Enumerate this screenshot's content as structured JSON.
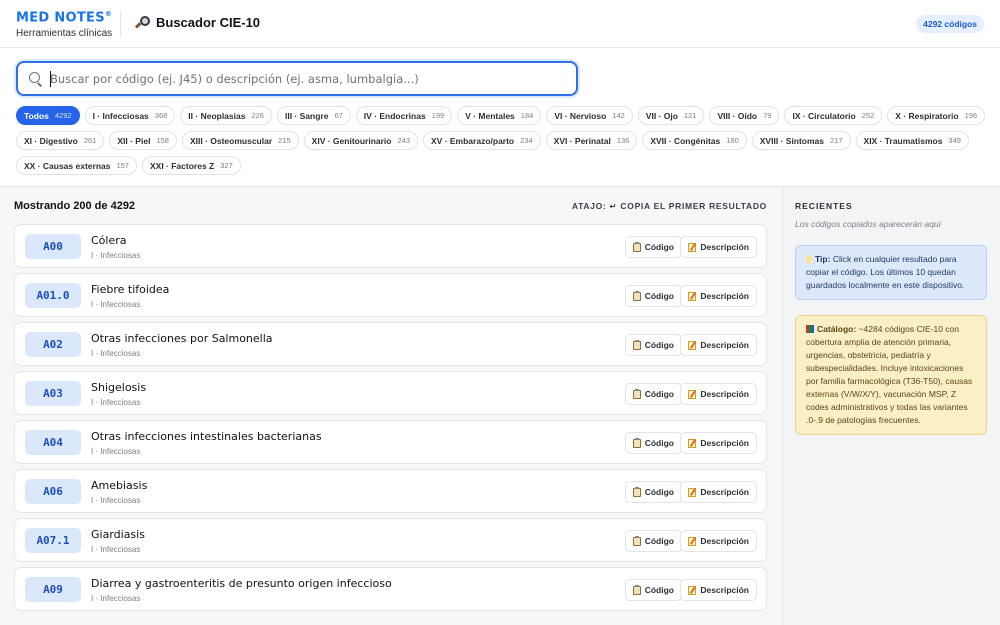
{
  "header": {
    "brand": "MED NOTES",
    "brand_mark": "®",
    "brand_subtitle": "Herramientas clínicas",
    "title": "Buscador CIE-10",
    "title_icon": "magnifier-icon",
    "total_badge": "4292 códigos"
  },
  "search": {
    "placeholder": "Buscar por código (ej. J45) o descripción (ej. asma, lumbalgia...)",
    "value": "",
    "icon": "search-icon"
  },
  "chapters": [
    {
      "label": "Todos",
      "count": "4292",
      "active": true
    },
    {
      "label": "I · Infecciosas",
      "count": "368"
    },
    {
      "label": "II · Neoplasias",
      "count": "226"
    },
    {
      "label": "III · Sangre",
      "count": "67"
    },
    {
      "label": "IV · Endocrinas",
      "count": "199"
    },
    {
      "label": "V · Mentales",
      "count": "184"
    },
    {
      "label": "VI · Nervioso",
      "count": "142"
    },
    {
      "label": "VII · Ojo",
      "count": "121"
    },
    {
      "label": "VIII · Oído",
      "count": "79"
    },
    {
      "label": "IX · Circulatorio",
      "count": "252"
    },
    {
      "label": "X · Respiratorio",
      "count": "196"
    },
    {
      "label": "XI · Digestivo",
      "count": "261"
    },
    {
      "label": "XII · Piel",
      "count": "158"
    },
    {
      "label": "XIII · Osteomuscular",
      "count": "215"
    },
    {
      "label": "XIV · Genitourinario",
      "count": "243"
    },
    {
      "label": "XV · Embarazo/parto",
      "count": "234"
    },
    {
      "label": "XVI · Perinatal",
      "count": "136"
    },
    {
      "label": "XVII · Congénitas",
      "count": "160"
    },
    {
      "label": "XVIII · Síntomas",
      "count": "217"
    },
    {
      "label": "XIX · Traumatismos",
      "count": "349"
    },
    {
      "label": "XX · Causas externas",
      "count": "157"
    },
    {
      "label": "XXI · Factores Z",
      "count": "327"
    }
  ],
  "results": {
    "summary": "Mostrando 200 de 4292",
    "shortcut": "ATAJO: ↵ COPIA EL PRIMER RESULTADO",
    "copy_code_label": "Código",
    "copy_desc_label": "Descripción",
    "items": [
      {
        "code": "A00",
        "title": "Cólera",
        "chapter": "I · Infecciosas"
      },
      {
        "code": "A01.0",
        "title": "Fiebre tifoidea",
        "chapter": "I · Infecciosas"
      },
      {
        "code": "A02",
        "title": "Otras infecciones por Salmonella",
        "chapter": "I · Infecciosas"
      },
      {
        "code": "A03",
        "title": "Shigelosis",
        "chapter": "I · Infecciosas"
      },
      {
        "code": "A04",
        "title": "Otras infecciones intestinales bacterianas",
        "chapter": "I · Infecciosas"
      },
      {
        "code": "A06",
        "title": "Amebiasis",
        "chapter": "I · Infecciosas"
      },
      {
        "code": "A07.1",
        "title": "Giardiasis",
        "chapter": "I · Infecciosas"
      },
      {
        "code": "A09",
        "title": "Diarrea y gastroenteritis de presunto origen infeccioso",
        "chapter": "I · Infecciosas"
      }
    ]
  },
  "sidebar": {
    "recent_title": "RECIENTES",
    "recent_empty": "Los códigos copiados aparecerán aquí",
    "tip_label": "Tip:",
    "tip_text": "Click en cualquier resultado para copiar el código. Los últimos 10 quedan guardados localmente en este dispositivo.",
    "catalog_label": "Catálogo:",
    "catalog_text": "~4284 códigos CIE-10 con cobertura amplia de atención primaria, urgencias, obstetricia, pediatría y subespecialidades. Incluye intoxicaciones por familia farmacológica (T36-T50), causas externas (V/W/X/Y), vacunación MSP, Z codes administrativos y todas las variantes .0-.9 de patologías frecuentes."
  },
  "colors": {
    "accent": "#2563eb",
    "brand": "#1a73e8",
    "code_pill_bg": "#dbe7fb",
    "tip_bg": "#dde9fb",
    "catalog_bg": "#fbefc8"
  }
}
